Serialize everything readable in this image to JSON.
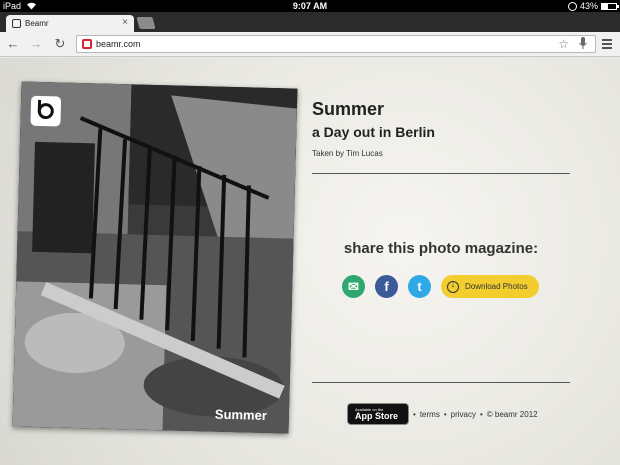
{
  "status_bar": {
    "device": "iPad",
    "time": "9:07 AM",
    "battery": "43%",
    "battery_level": 0.43
  },
  "browser": {
    "tab_title": "Beamr",
    "url": "beamr.com"
  },
  "icons": {
    "back": "back-arrow-icon",
    "forward": "forward-arrow-icon",
    "reload": "reload-icon",
    "bookmark": "star-icon",
    "voice": "microphone-icon",
    "menu": "menu-icon"
  },
  "magazine": {
    "title": "Summer",
    "subtitle": "a Day out in Berlin",
    "credit": "Taken by Tim Lucas",
    "cover_title": "Summer"
  },
  "share": {
    "heading": "share this photo magazine:",
    "email_glyph": "✉",
    "facebook_glyph": "f",
    "twitter_glyph": "t",
    "download_label": "Download Photos"
  },
  "footer": {
    "appstore_small": "Available on the",
    "appstore_big": "App Store",
    "terms": "terms",
    "privacy": "privacy",
    "copyright": "© beamr 2012"
  },
  "colors": {
    "email": "#2fa86f",
    "facebook": "#3b5b98",
    "twitter": "#2ea8e6",
    "download": "#f2cd2d",
    "brand_red": "#d4262c"
  }
}
